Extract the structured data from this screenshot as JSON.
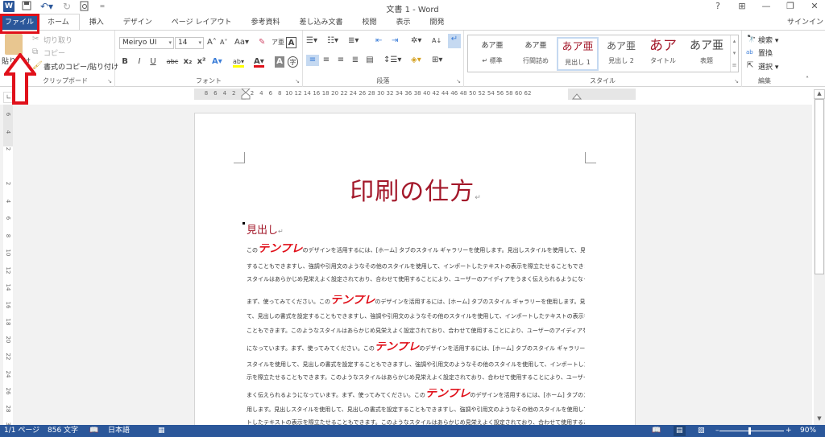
{
  "titlebar": {
    "title": "文書 1 - Word",
    "qat": [
      {
        "icon": "word-logo-icon",
        "glyph": "W"
      },
      {
        "icon": "save-icon",
        "glyph": "💾"
      },
      {
        "icon": "undo-icon",
        "glyph": "↶▾"
      },
      {
        "icon": "redo-icon",
        "glyph": "↻"
      },
      {
        "icon": "print-preview-icon",
        "glyph": "🔍"
      },
      {
        "icon": "customize-qat-icon",
        "glyph": "="
      }
    ],
    "controls": [
      {
        "icon": "help-icon",
        "glyph": "?"
      },
      {
        "icon": "ribbon-display-icon",
        "glyph": "⊞"
      },
      {
        "icon": "minimize-icon",
        "glyph": "—"
      },
      {
        "icon": "restore-icon",
        "glyph": "❐"
      },
      {
        "icon": "close-icon",
        "glyph": "✕"
      }
    ]
  },
  "tabs": [
    "ファイル",
    "ホーム",
    "挿入",
    "デザイン",
    "ページ レイアウト",
    "参考資料",
    "差し込み文書",
    "校閲",
    "表示",
    "開発"
  ],
  "active_tab": "ホーム",
  "signin": "サインイン",
  "ribbon": {
    "clipboard": {
      "label": "クリップボード",
      "paste": "貼り付け",
      "cut": "切り取り",
      "copy": "コピー",
      "format_painter": "書式のコピー/貼り付け"
    },
    "font": {
      "label": "フォント",
      "font_name": "Meiryo UI",
      "font_size": "14",
      "buttons": [
        "B",
        "I",
        "U",
        "abc",
        "x₂",
        "x²"
      ]
    },
    "paragraph": {
      "label": "段落"
    },
    "styles": {
      "label": "スタイル",
      "items": [
        {
          "preview": "あア亜",
          "name": "↵ 標準"
        },
        {
          "preview": "あア亜",
          "name": "行間詰め"
        },
        {
          "preview": "あア亜",
          "name": "見出し 1"
        },
        {
          "preview": "あア亜",
          "name": "見出し 2"
        },
        {
          "preview": "あア",
          "name": "タイトル"
        },
        {
          "preview": "あア亜",
          "name": "表題"
        }
      ],
      "selected": "見出し 1"
    },
    "editing": {
      "label": "編集",
      "find": "検索",
      "replace": "置換",
      "select": "選択"
    }
  },
  "ruler": {
    "h_ticks": [
      "8",
      "6",
      "4",
      "2",
      "",
      "2",
      "4",
      "6",
      "8",
      "10",
      "12",
      "14",
      "16",
      "18",
      "20",
      "22",
      "24",
      "26",
      "28",
      "30",
      "32",
      "34",
      "36",
      "38",
      "40",
      "42",
      "44",
      "46",
      "48",
      "50",
      "52",
      "54",
      "56",
      "58",
      "60",
      "62"
    ],
    "v_ticks": [
      "6",
      "4",
      "2",
      "",
      "2",
      "4",
      "6",
      "8",
      "10",
      "12",
      "14",
      "16",
      "18",
      "20",
      "22",
      "24",
      "26",
      "28",
      "30"
    ]
  },
  "document": {
    "title": "印刷の仕方",
    "heading": "見出し",
    "emphasis": "テンプレ",
    "lines": [
      {
        "pre": "この",
        "emph": true,
        "post": "のデザインを活用するには、[ホーム] タブのスタイル ギャラリーを使用します。見出しスタイルを使用して、見出しの書式を設定"
      },
      {
        "pre": "することもできますし、強調や引用文のようなその他のスタイルを使用して、インポートしたテキストの表示を際立たせることもできます。このような",
        "emph": false,
        "post": ""
      },
      {
        "pre": "スタイルはあらかじめ見栄えよく設定されており、合わせて使用することにより、ユーザーのアイディアをうまく伝えられるようになっています。",
        "emph": false,
        "post": ""
      },
      {
        "pre": "まず、使ってみてください。この",
        "emph": true,
        "post": "のデザインを活用するには、[ホーム] タブのスタイル ギャラリーを使用します。見出しスタイルを使用し"
      },
      {
        "pre": "て、見出しの書式を設定することもできますし、強調や引用文のようなその他のスタイルを使用して、インポートしたテキストの表示を際立たせる",
        "emph": false,
        "post": ""
      },
      {
        "pre": "こともできます。このようなスタイルはあらかじめ見栄えよく設定されており、合わせて使用することにより、ユーザーのアイディアをうまく伝えられるよう",
        "emph": false,
        "post": ""
      },
      {
        "pre": "になっています。まず、使ってみてください。この",
        "emph": true,
        "post": "のデザインを活用するには、[ホーム] タブのスタイル ギャラリーを使用します。見出し"
      },
      {
        "pre": "スタイルを使用して、見出しの書式を設定することもできますし、強調や引用文のようなその他のスタイルを使用して、インポートしたテキストの表",
        "emph": false,
        "post": ""
      },
      {
        "pre": "示を際立たせることもできます。このようなスタイルはあらかじめ見栄えよく設定されており、合わせて使用することにより、ユーザーのアイディアをう",
        "emph": false,
        "post": ""
      },
      {
        "pre": "まく伝えられるようになっています。まず、使ってみてください。この",
        "emph": true,
        "post": "のデザインを活用するには、[ホーム] タブのスタイル ギャラリーを使"
      },
      {
        "pre": "用します。見出しスタイルを使用して、見出しの書式を設定することもできますし、強調や引用文のようなその他のスタイルを使用して、インポー",
        "emph": false,
        "post": ""
      },
      {
        "pre": "トしたテキストの表示を際立たせることもできます。このようなスタイルはあらかじめ見栄えよく設定されており、合わせて使用することにより、ユーザ",
        "emph": false,
        "post": ""
      }
    ]
  },
  "statusbar": {
    "page": "1/1 ページ",
    "words": "856 文字",
    "language": "日本語",
    "zoom": "90%",
    "zoom_percent": 90
  },
  "colors": {
    "accent": "#2b579a",
    "highlight_box": "#e0101a",
    "title_red": "#a3182a"
  }
}
